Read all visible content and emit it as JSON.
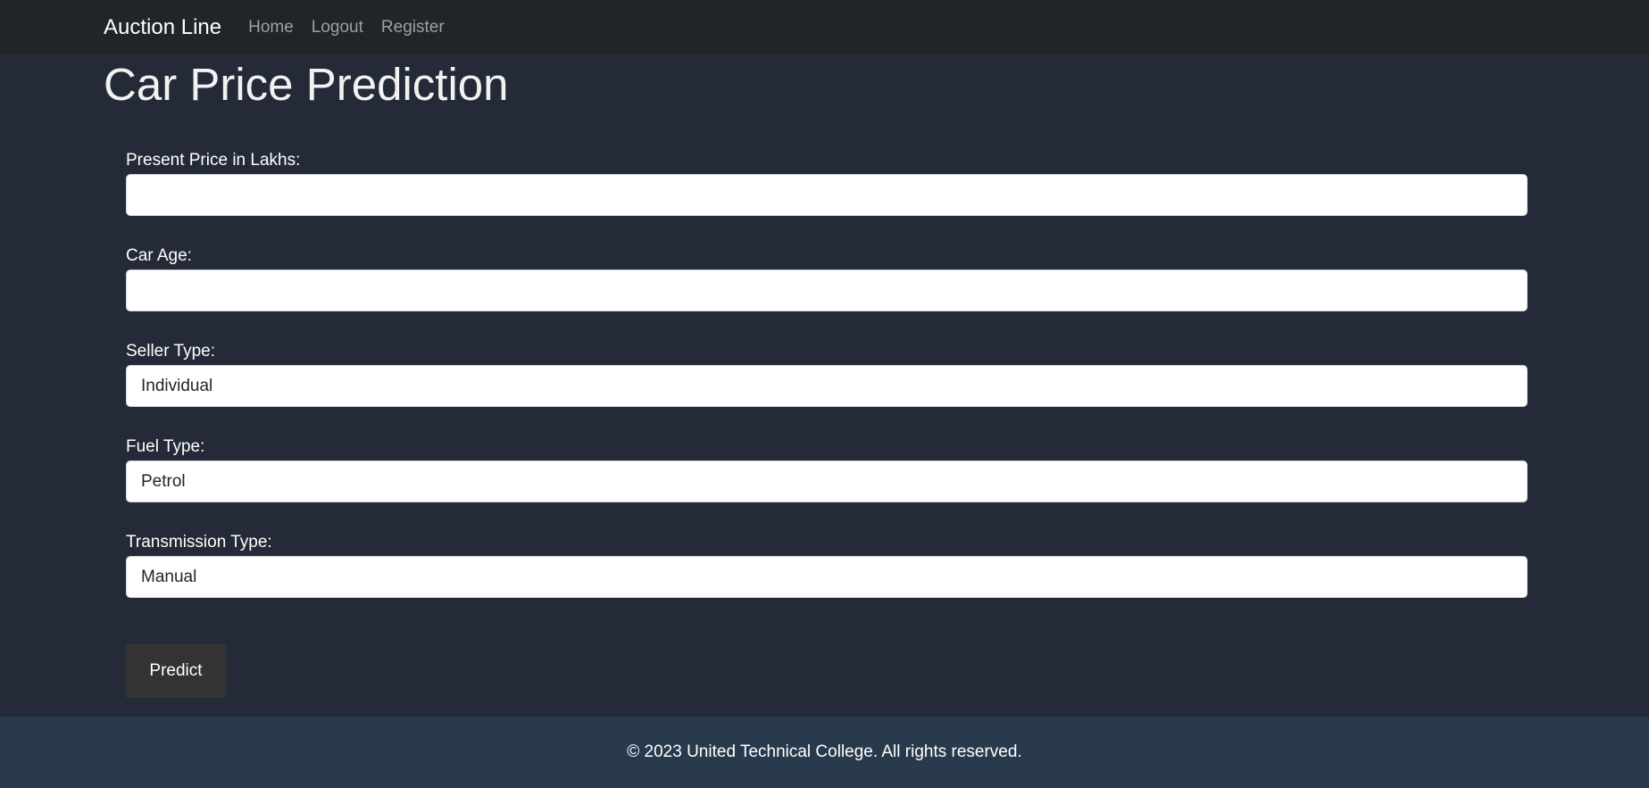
{
  "navbar": {
    "brand": "Auction Line",
    "links": [
      "Home",
      "Logout",
      "Register"
    ]
  },
  "page": {
    "title": "Car Price Prediction"
  },
  "form": {
    "present_price": {
      "label": "Present Price in Lakhs:",
      "value": ""
    },
    "car_age": {
      "label": "Car Age:",
      "value": ""
    },
    "seller_type": {
      "label": "Seller Type:",
      "value": "Individual"
    },
    "fuel_type": {
      "label": "Fuel Type:",
      "value": "Petrol"
    },
    "transmission_type": {
      "label": "Transmission Type:",
      "value": "Manual"
    },
    "submit_label": "Predict"
  },
  "footer": {
    "text": "© 2023 United Technical College. All rights reserved."
  },
  "colors": {
    "navbar_bg": "#212429",
    "page_bg": "#242a37",
    "footer_bg": "#2a3a4d",
    "button_bg": "#333333",
    "nav_link": "#9aa0a6"
  }
}
